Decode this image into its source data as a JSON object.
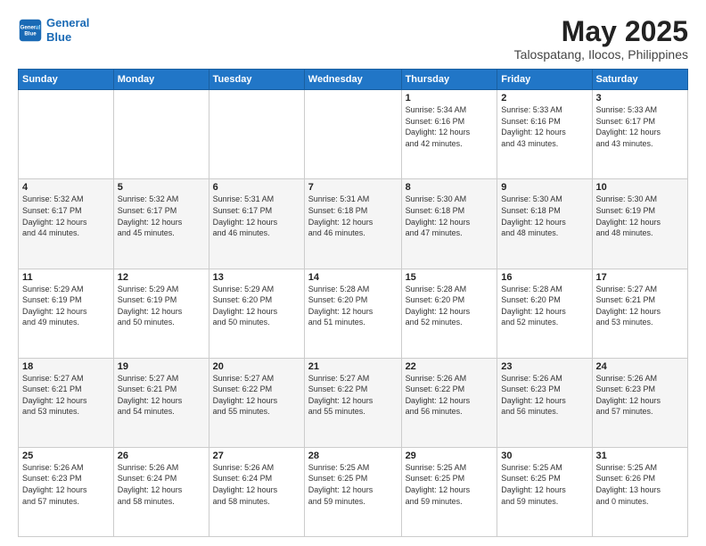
{
  "logo": {
    "line1": "General",
    "line2": "Blue"
  },
  "title": "May 2025",
  "subtitle": "Talospatang, Ilocos, Philippines",
  "days_of_week": [
    "Sunday",
    "Monday",
    "Tuesday",
    "Wednesday",
    "Thursday",
    "Friday",
    "Saturday"
  ],
  "weeks": [
    [
      {
        "day": "",
        "info": ""
      },
      {
        "day": "",
        "info": ""
      },
      {
        "day": "",
        "info": ""
      },
      {
        "day": "",
        "info": ""
      },
      {
        "day": "1",
        "info": "Sunrise: 5:34 AM\nSunset: 6:16 PM\nDaylight: 12 hours\nand 42 minutes."
      },
      {
        "day": "2",
        "info": "Sunrise: 5:33 AM\nSunset: 6:16 PM\nDaylight: 12 hours\nand 43 minutes."
      },
      {
        "day": "3",
        "info": "Sunrise: 5:33 AM\nSunset: 6:17 PM\nDaylight: 12 hours\nand 43 minutes."
      }
    ],
    [
      {
        "day": "4",
        "info": "Sunrise: 5:32 AM\nSunset: 6:17 PM\nDaylight: 12 hours\nand 44 minutes."
      },
      {
        "day": "5",
        "info": "Sunrise: 5:32 AM\nSunset: 6:17 PM\nDaylight: 12 hours\nand 45 minutes."
      },
      {
        "day": "6",
        "info": "Sunrise: 5:31 AM\nSunset: 6:17 PM\nDaylight: 12 hours\nand 46 minutes."
      },
      {
        "day": "7",
        "info": "Sunrise: 5:31 AM\nSunset: 6:18 PM\nDaylight: 12 hours\nand 46 minutes."
      },
      {
        "day": "8",
        "info": "Sunrise: 5:30 AM\nSunset: 6:18 PM\nDaylight: 12 hours\nand 47 minutes."
      },
      {
        "day": "9",
        "info": "Sunrise: 5:30 AM\nSunset: 6:18 PM\nDaylight: 12 hours\nand 48 minutes."
      },
      {
        "day": "10",
        "info": "Sunrise: 5:30 AM\nSunset: 6:19 PM\nDaylight: 12 hours\nand 48 minutes."
      }
    ],
    [
      {
        "day": "11",
        "info": "Sunrise: 5:29 AM\nSunset: 6:19 PM\nDaylight: 12 hours\nand 49 minutes."
      },
      {
        "day": "12",
        "info": "Sunrise: 5:29 AM\nSunset: 6:19 PM\nDaylight: 12 hours\nand 50 minutes."
      },
      {
        "day": "13",
        "info": "Sunrise: 5:29 AM\nSunset: 6:20 PM\nDaylight: 12 hours\nand 50 minutes."
      },
      {
        "day": "14",
        "info": "Sunrise: 5:28 AM\nSunset: 6:20 PM\nDaylight: 12 hours\nand 51 minutes."
      },
      {
        "day": "15",
        "info": "Sunrise: 5:28 AM\nSunset: 6:20 PM\nDaylight: 12 hours\nand 52 minutes."
      },
      {
        "day": "16",
        "info": "Sunrise: 5:28 AM\nSunset: 6:20 PM\nDaylight: 12 hours\nand 52 minutes."
      },
      {
        "day": "17",
        "info": "Sunrise: 5:27 AM\nSunset: 6:21 PM\nDaylight: 12 hours\nand 53 minutes."
      }
    ],
    [
      {
        "day": "18",
        "info": "Sunrise: 5:27 AM\nSunset: 6:21 PM\nDaylight: 12 hours\nand 53 minutes."
      },
      {
        "day": "19",
        "info": "Sunrise: 5:27 AM\nSunset: 6:21 PM\nDaylight: 12 hours\nand 54 minutes."
      },
      {
        "day": "20",
        "info": "Sunrise: 5:27 AM\nSunset: 6:22 PM\nDaylight: 12 hours\nand 55 minutes."
      },
      {
        "day": "21",
        "info": "Sunrise: 5:27 AM\nSunset: 6:22 PM\nDaylight: 12 hours\nand 55 minutes."
      },
      {
        "day": "22",
        "info": "Sunrise: 5:26 AM\nSunset: 6:22 PM\nDaylight: 12 hours\nand 56 minutes."
      },
      {
        "day": "23",
        "info": "Sunrise: 5:26 AM\nSunset: 6:23 PM\nDaylight: 12 hours\nand 56 minutes."
      },
      {
        "day": "24",
        "info": "Sunrise: 5:26 AM\nSunset: 6:23 PM\nDaylight: 12 hours\nand 57 minutes."
      }
    ],
    [
      {
        "day": "25",
        "info": "Sunrise: 5:26 AM\nSunset: 6:23 PM\nDaylight: 12 hours\nand 57 minutes."
      },
      {
        "day": "26",
        "info": "Sunrise: 5:26 AM\nSunset: 6:24 PM\nDaylight: 12 hours\nand 58 minutes."
      },
      {
        "day": "27",
        "info": "Sunrise: 5:26 AM\nSunset: 6:24 PM\nDaylight: 12 hours\nand 58 minutes."
      },
      {
        "day": "28",
        "info": "Sunrise: 5:25 AM\nSunset: 6:25 PM\nDaylight: 12 hours\nand 59 minutes."
      },
      {
        "day": "29",
        "info": "Sunrise: 5:25 AM\nSunset: 6:25 PM\nDaylight: 12 hours\nand 59 minutes."
      },
      {
        "day": "30",
        "info": "Sunrise: 5:25 AM\nSunset: 6:25 PM\nDaylight: 12 hours\nand 59 minutes."
      },
      {
        "day": "31",
        "info": "Sunrise: 5:25 AM\nSunset: 6:26 PM\nDaylight: 13 hours\nand 0 minutes."
      }
    ]
  ]
}
